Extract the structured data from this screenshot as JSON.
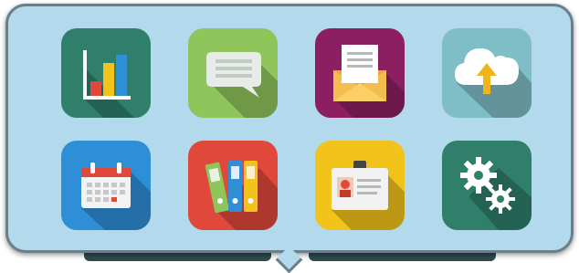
{
  "launcher": {
    "tiles": [
      {
        "icon": "bar-chart-icon",
        "color": "#2f7f6b"
      },
      {
        "icon": "speech-bubble-icon",
        "color": "#8fc55b"
      },
      {
        "icon": "mail-envelope-icon",
        "color": "#8b1f62"
      },
      {
        "icon": "cloud-upload-icon",
        "color": "#7fbec7"
      },
      {
        "icon": "calendar-icon",
        "color": "#2f8fd6"
      },
      {
        "icon": "binders-icon",
        "color": "#e0483c"
      },
      {
        "icon": "id-card-icon",
        "color": "#f1c31b"
      },
      {
        "icon": "settings-gears-icon",
        "color": "#2f7f6b"
      }
    ]
  },
  "colors": {
    "panel_bg": "#b3d9ec",
    "panel_border": "#6b7f8a"
  }
}
